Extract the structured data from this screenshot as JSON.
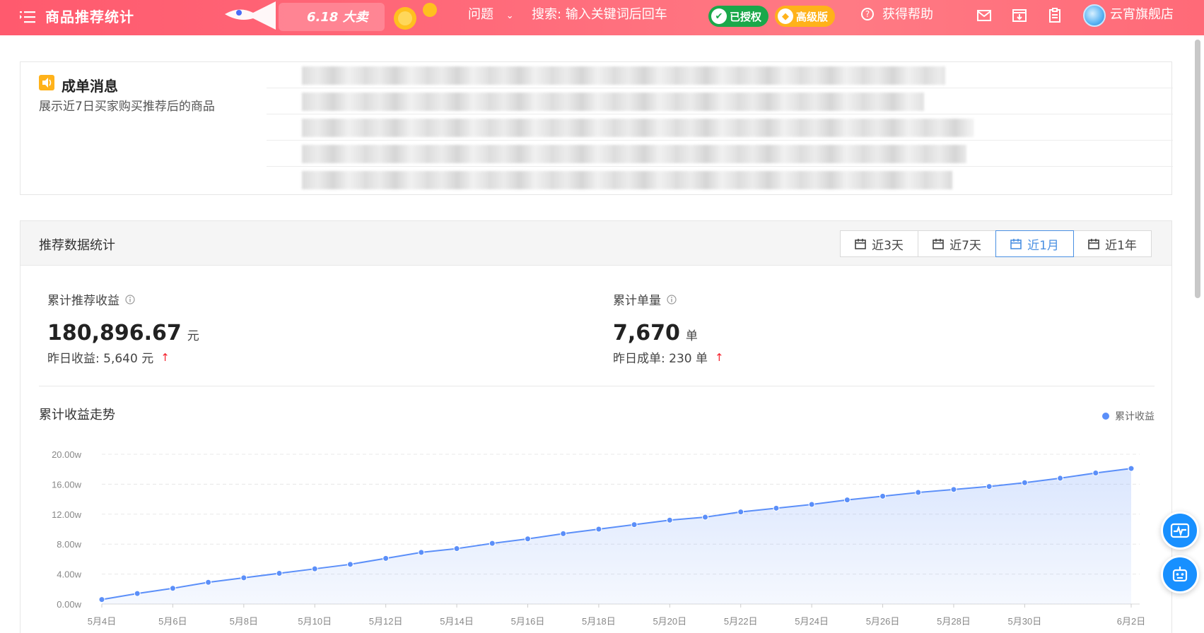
{
  "header": {
    "title": "商品推荐统计",
    "promo": "6.18 大卖",
    "problem_label": "问题",
    "search_label": "搜索: 输入关键词后回车",
    "authorized_badge": "已授权",
    "pro_badge": "高级版",
    "help_label": "获得帮助",
    "shop_name": "云宵旗舰店"
  },
  "message": {
    "title": "成单消息",
    "subtitle": "展示近7日买家购买推荐后的商品"
  },
  "stats": {
    "title": "推荐数据统计",
    "ranges": [
      "近3天",
      "近7天",
      "近1月",
      "近1年"
    ],
    "active_range": "近1月",
    "revenue": {
      "label": "累计推荐收益",
      "value": "180,896.67",
      "unit": "元",
      "yesterday": "昨日收益: 5,640 元"
    },
    "orders": {
      "label": "累计单量",
      "value": "7,670",
      "unit": "单",
      "yesterday": "昨日成单: 230 单"
    },
    "chart_title": "累计收益走势",
    "legend_label": "累计收益"
  },
  "chart_data": {
    "type": "area",
    "series": [
      {
        "name": "累计收益",
        "color": "#5b8ff9",
        "values": [
          0.6,
          1.4,
          2.1,
          2.9,
          3.5,
          4.1,
          4.7,
          5.3,
          6.1,
          6.9,
          7.4,
          8.1,
          8.7,
          9.4,
          10.0,
          10.6,
          11.2,
          11.6,
          12.3,
          12.8,
          13.3,
          13.9,
          14.4,
          14.9,
          15.3,
          15.7,
          16.2,
          16.8,
          17.5,
          18.1
        ]
      }
    ],
    "x_labels": [
      "5月4日",
      "5月6日",
      "5月8日",
      "5月10日",
      "5月12日",
      "5月14日",
      "5月16日",
      "5月18日",
      "5月20日",
      "5月22日",
      "5月24日",
      "5月26日",
      "5月28日",
      "5月30日",
      "6月2日"
    ],
    "y_ticks": [
      "0.00w",
      "4.00w",
      "8.00w",
      "12.00w",
      "16.00w",
      "20.00w"
    ],
    "ylim": [
      0,
      20
    ],
    "ylabel_unit": "w",
    "grid": true,
    "legend_position": "top-right"
  }
}
